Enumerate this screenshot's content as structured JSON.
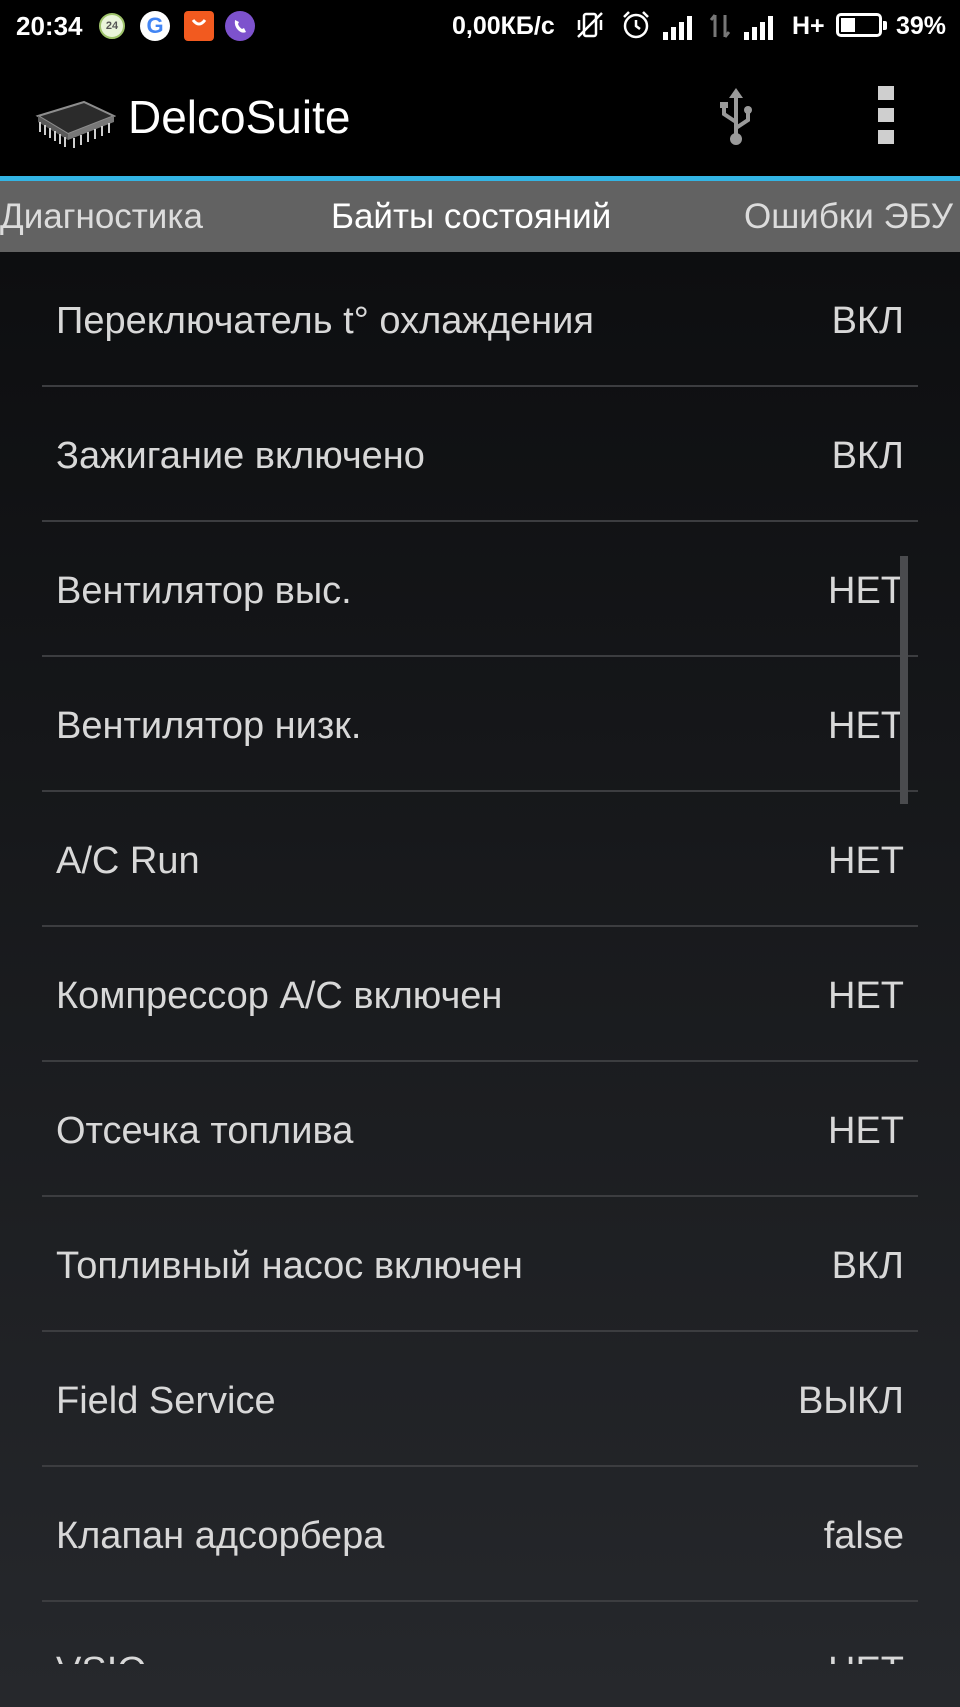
{
  "status_bar": {
    "time": "20:34",
    "icons": [
      "news24-icon",
      "google-icon",
      "aliexpress-icon",
      "viber-icon"
    ],
    "notification_24_text": "24",
    "google_letter": "G",
    "net_speed": "0,00КБ/с",
    "network_type": "H+",
    "battery_percent": "39%",
    "battery_level": 0.39
  },
  "action_bar": {
    "title": "DelcoSuite",
    "accent_color": "#33b5e5"
  },
  "tabs": {
    "previous": "Диагностика",
    "active": "Байты состояний",
    "next": "Ошибки ЭБУ"
  },
  "list": {
    "items": [
      {
        "label": "Переключатель t° охлаждения",
        "value": "ВКЛ"
      },
      {
        "label": "Зажигание включено",
        "value": "ВКЛ"
      },
      {
        "label": "Вентилятор выс.",
        "value": "НЕТ"
      },
      {
        "label": "Вентилятор низк.",
        "value": "НЕТ"
      },
      {
        "label": "A/C Run",
        "value": "НЕТ"
      },
      {
        "label": "Компрессор A/C включен",
        "value": "НЕТ"
      },
      {
        "label": "Отсечка топлива",
        "value": "НЕТ"
      },
      {
        "label": "Топливный насос включен",
        "value": "ВКЛ"
      },
      {
        "label": "Field Service",
        "value": "ВЫКЛ"
      },
      {
        "label": "Клапан адсорбера",
        "value": "false"
      },
      {
        "label": "VSIO",
        "value": "НЕТ"
      }
    ]
  }
}
